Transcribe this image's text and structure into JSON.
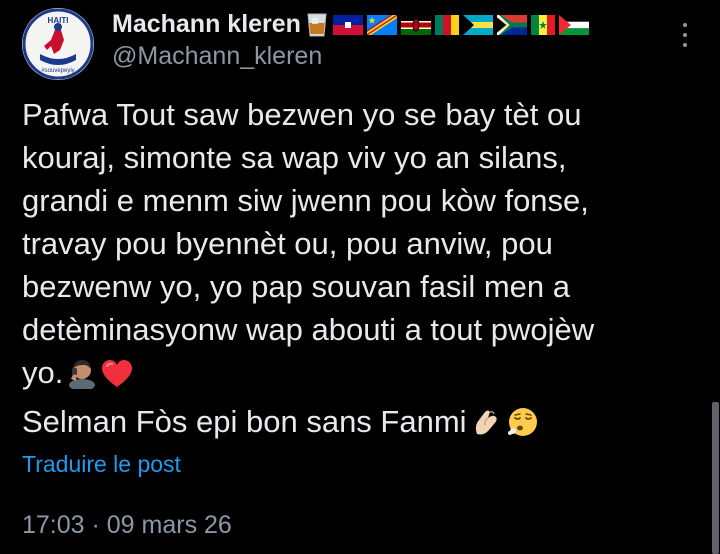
{
  "author": {
    "display_name": "Machann kleren",
    "handle": "@Machann_kleren",
    "avatar_text": "HAITI",
    "avatar_subtext": "#souvepeyiy",
    "name_icons": [
      "tumbler-glass-icon",
      "flag-haiti-icon",
      "flag-dr-congo-icon",
      "flag-kenya-icon",
      "flag-cameroon-icon",
      "flag-bahamas-icon",
      "flag-south-africa-icon",
      "flag-senegal-icon",
      "flag-palestine-icon"
    ]
  },
  "tweet": {
    "lines": [
      "Pafwa Tout saw bezwen yo  se bay tèt ou",
      "kouraj, simonte sa wap viv yo an silans,",
      "grandi  e menm siw jwenn pou kòw fonse,",
      "travay pou byennèt ou, pou anviw,  pou",
      "bezwenw yo, yo pap souvan fasil men a",
      "detèminasyonw wap abouti a tout pwojèw",
      "yo.",
      "Selman Fòs epi  bon sans Fanmi"
    ],
    "line7_emojis": [
      "man-on-phone-emoji",
      "red-heart-emoji"
    ],
    "line8_emojis": [
      "pinching-hand-emoji",
      "face-exhaling-emoji"
    ]
  },
  "actions": {
    "translate_label": "Traduire le post"
  },
  "meta": {
    "timestamp": "17:03 · 09 mars 26"
  },
  "colors": {
    "background": "#000000",
    "text": "#e7e9ea",
    "secondary": "#8b98a5",
    "link": "#1d9bf0"
  }
}
